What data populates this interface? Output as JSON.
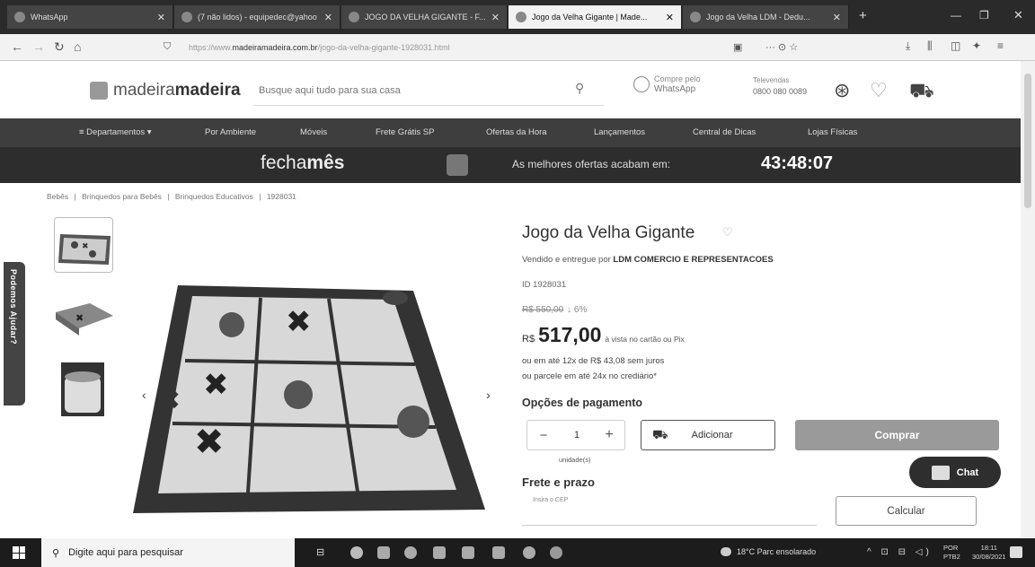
{
  "browser": {
    "tabs": [
      {
        "label": "WhatsApp"
      },
      {
        "label": "(7 não lidos) - equipedec@yahoo"
      },
      {
        "label": "JOGO DA VELHA GIGANTE - F..."
      },
      {
        "label": "Jogo da Velha Gigante | Made..."
      },
      {
        "label": "Jogo da Velha LDM - Dedu..."
      }
    ],
    "new_tab": "+",
    "url_prefix": "https://www.",
    "url_domain": "madeiramadeira.com.br",
    "url_rest": "/jogo-da-velha-gigante-1928031.html",
    "url_menu": "··· ⊙ ☆"
  },
  "header": {
    "logo_light": "madeira",
    "logo_bold": "madeira",
    "search_placeholder": "Busque aqui tudo para sua casa",
    "whatsapp_line1": "Compre pelo",
    "whatsapp_line2": "WhatsApp",
    "tele_label": "Televendas",
    "tele_number": "0800 080 0089"
  },
  "departments": [
    "≡  Departamentos  ▾",
    "Por Ambiente",
    "Móveis",
    "Frete Grátis SP",
    "Ofertas da Hora",
    "Lançamentos",
    "Central de Dicas",
    "Lojas Físicas"
  ],
  "promo": {
    "fecha": "fecha",
    "mes": "mês",
    "text": "As melhores ofertas acabam em:",
    "timer": "43:48:07"
  },
  "breadcrumb": [
    "Bebês",
    "|",
    "Brinquedos para Bebês",
    "|",
    "Brinquedos Educativos",
    "|",
    "1928031"
  ],
  "side_help": "Podemos Ajudar?",
  "product": {
    "title": "Jogo da Velha Gigante",
    "seller_prefix": "Vendido e entregue por",
    "seller_name": "LDM COMERCIO E REPRESENTACOES",
    "id": "ID 1928031",
    "old_price": "R$ 550,00",
    "discount": "↓ 6%",
    "currency": "R$",
    "price": "517,00",
    "price_note": "à vista no cartão ou Pix",
    "installments": "ou em até 12x de R$ 43,08 sem juros",
    "installments2": "ou parcele em até 24x no crediário*",
    "payment_options": "Opções de pagamento",
    "quantity": "1",
    "minus": "−",
    "plus": "+",
    "unit_label": "unidade(s)",
    "add_label": "Adicionar",
    "buy_label": "Comprar",
    "shipping_title": "Frete e prazo",
    "cep_label": "Insira o CEP",
    "calc_label": "Calcular"
  },
  "chat_label": "Chat",
  "taskbar": {
    "search_text": "Digite aqui para pesquisar",
    "weather": "18°C  Parc ensolarado",
    "tray": "^ ⊡ ⊟ ◁)",
    "lang1": "POR",
    "lang2": "PTB2",
    "time": "18:11",
    "date": "30/08/2021"
  },
  "colors": {
    "tab_bar": "#2a2a2a",
    "dept_bar": "#3e3e3e",
    "promo_bar": "#2d2d2d",
    "buy_button": "#9a9a9a"
  }
}
